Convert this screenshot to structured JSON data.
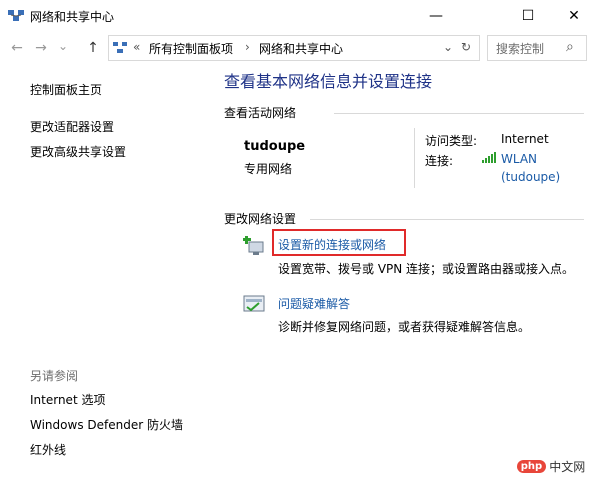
{
  "window": {
    "title": "网络和共享中心",
    "minimize_glyph": "—",
    "maximize_glyph": "☐",
    "close_glyph": "✕"
  },
  "nav": {
    "back_glyph": "←",
    "forward_glyph": "→",
    "dropdown_glyph": "⌄",
    "up_glyph": "↑",
    "overflow_glyph": "«",
    "breadcrumbs": [
      "所有控制面板项",
      "网络和共享中心"
    ],
    "separator_glyph": "›",
    "refresh_glyph": "↻",
    "search_placeholder": "搜索控制",
    "search_glyph": "⌕"
  },
  "sidebar": {
    "items": [
      {
        "label": "控制面板主页"
      },
      {
        "label": "更改适配器设置"
      },
      {
        "label": "更改高级共享设置"
      }
    ],
    "see_also_title": "另请参阅",
    "see_also": [
      {
        "label": "Internet 选项"
      },
      {
        "label": "Windows Defender 防火墙"
      },
      {
        "label": "红外线"
      }
    ]
  },
  "main": {
    "heading": "查看基本网络信息并设置连接",
    "active_networks_label": "查看活动网络",
    "network": {
      "name": "tudoupe",
      "category": "专用网络",
      "access_type_label": "访问类型:",
      "access_type_value": "Internet",
      "connections_label": "连接:",
      "connection_link_line1": "WLAN",
      "connection_link_line2": "(tudoupe)"
    },
    "change_settings_label": "更改网络设置",
    "tasks": [
      {
        "title": "设置新的连接或网络",
        "desc": "设置宽带、拨号或 VPN 连接；或设置路由器或接入点。"
      },
      {
        "title": "问题疑难解答",
        "desc": "诊断并修复网络问题，或者获得疑难解答信息。"
      }
    ]
  },
  "watermark": {
    "text": "中文网",
    "badge": "php"
  },
  "colors": {
    "link": "#1a5aa6",
    "heading": "#1e3287",
    "highlight_box": "#e02a2a",
    "signal": "#2e9e2e"
  }
}
